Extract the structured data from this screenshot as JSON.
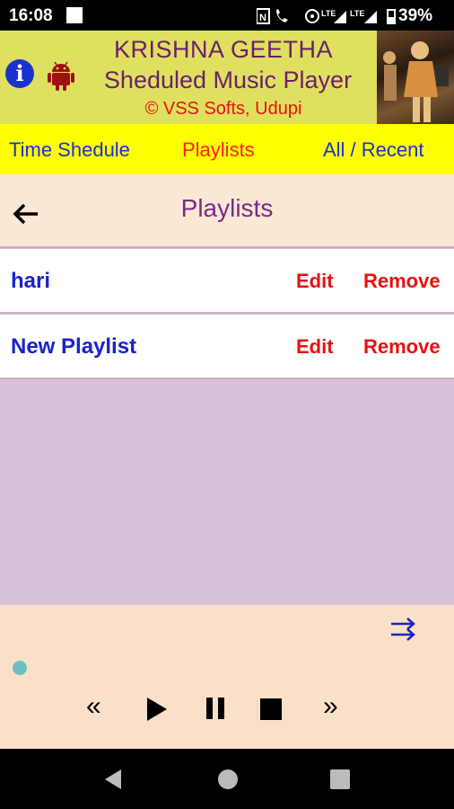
{
  "status_bar": {
    "time": "16:08",
    "battery": "39%"
  },
  "header": {
    "title_line1": "KRISHNA GEETHA",
    "title_line2": "Sheduled Music Player",
    "credit": "© VSS Softs, Udupi",
    "info_glyph": "i"
  },
  "tabs": [
    {
      "label": "Time Shedule"
    },
    {
      "label": "Playlists"
    },
    {
      "label": "All / Recent"
    }
  ],
  "page": {
    "title": "Playlists"
  },
  "playlists": [
    {
      "name": "hari",
      "edit_label": "Edit",
      "remove_label": "Remove"
    },
    {
      "name": "New Playlist",
      "edit_label": "Edit",
      "remove_label": "Remove"
    }
  ],
  "player": {
    "controls": [
      "rewind-icon",
      "play-icon",
      "pause-icon",
      "stop-icon",
      "fast-forward-icon"
    ],
    "rewind_glyph": "«",
    "forward_glyph": "»"
  },
  "colors": {
    "header_bg": "#e0e060",
    "tab_bg": "#ffff00",
    "active_tab": "#ff2020",
    "tab_text": "#1a33cc",
    "action_red": "#e81010",
    "list_bg": "#d8c0d8"
  }
}
